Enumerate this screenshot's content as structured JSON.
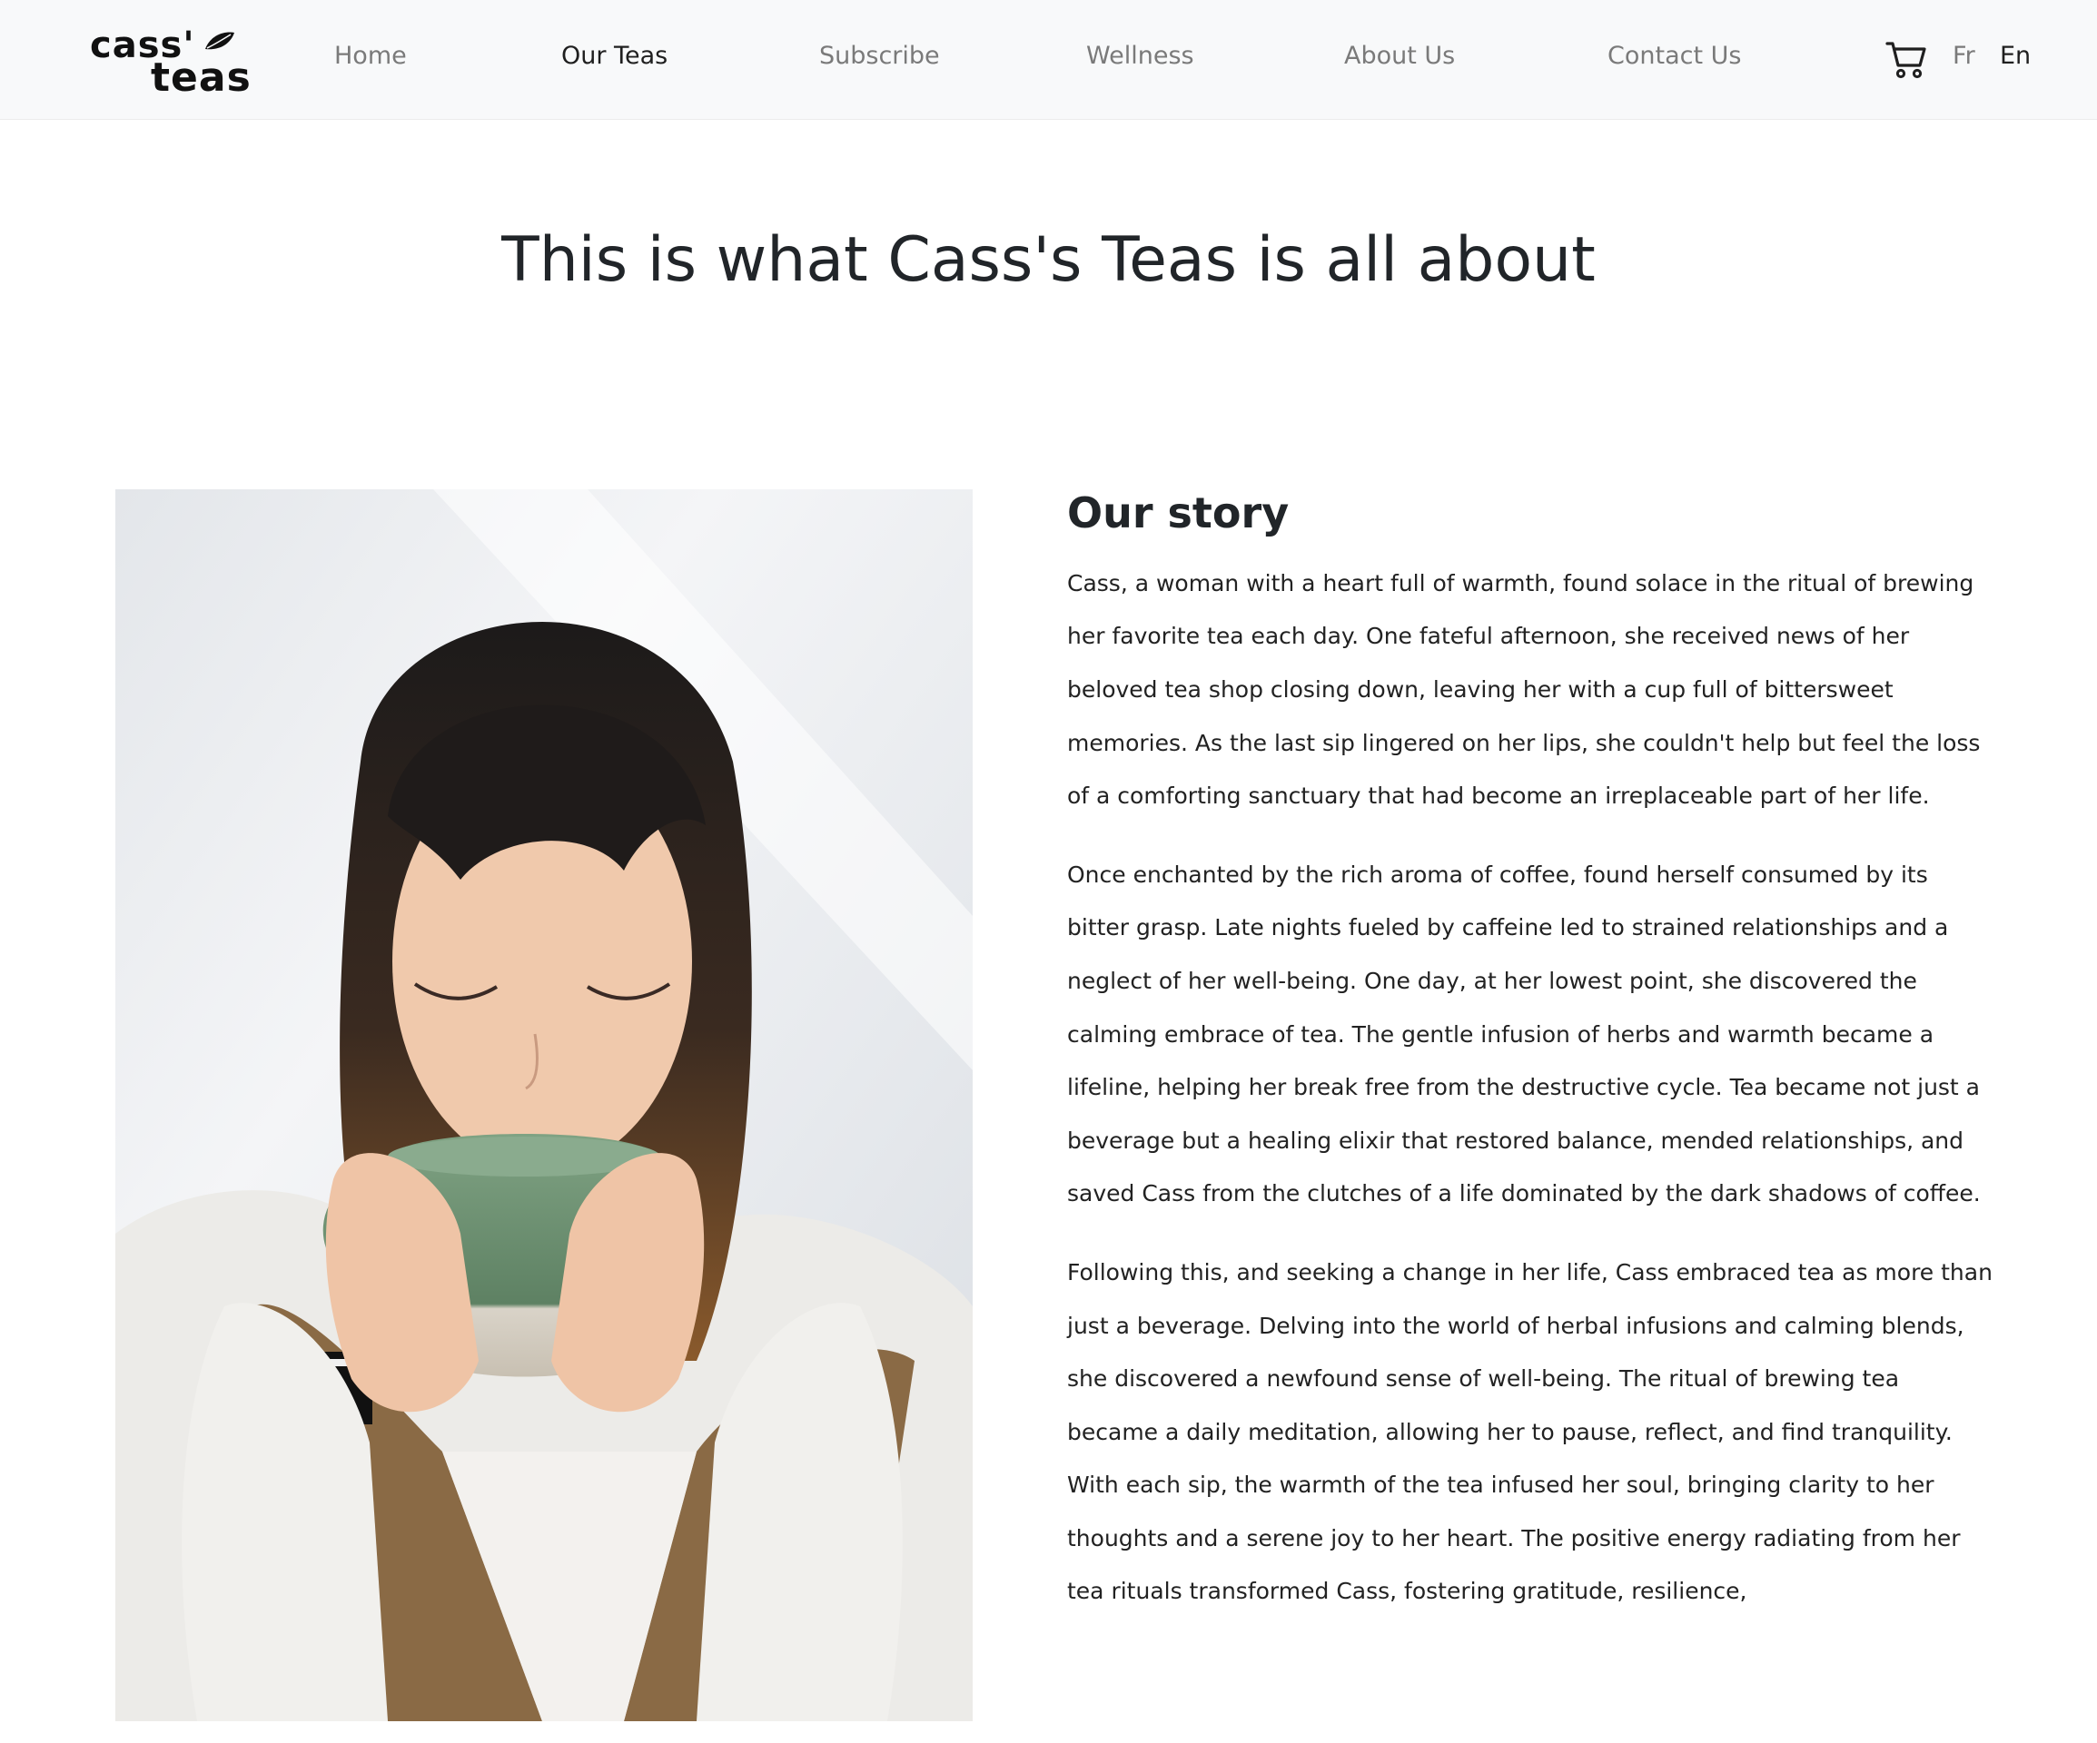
{
  "brand": {
    "line1": "cass'",
    "line2": "teas"
  },
  "nav": {
    "home": "Home",
    "our_teas": "Our Teas",
    "subscribe": "Subscribe",
    "wellness": "Wellness",
    "about": "About Us",
    "contact": "Contact Us"
  },
  "icons": {
    "cart": "cart-icon",
    "logo_leaf": "leaf-icon"
  },
  "lang": {
    "fr": "Fr",
    "en": "En"
  },
  "hero": {
    "title": "This is what Cass's Teas is all about"
  },
  "story": {
    "heading": "Our story",
    "paragraphs": [
      "Cass, a woman with a heart full of warmth, found solace in the ritual of brewing her favorite tea each day. One fateful afternoon, she received news of her beloved tea shop closing down, leaving her with a cup full of bittersweet memories. As the last sip lingered on her lips, she couldn't help but feel the loss of a comforting sanctuary that had become an irreplaceable part of her life.",
      "Once enchanted by the rich aroma of coffee, found herself consumed by its bitter grasp. Late nights fueled by caffeine led to strained relationships and a neglect of her well-being. One day, at her lowest point, she discovered the calming embrace of tea. The gentle infusion of herbs and warmth became a lifeline, helping her break free from the destructive cycle. Tea became not just a beverage but a healing elixir that restored balance, mended relationships, and saved Cass from the clutches of a life dominated by the dark shadows of coffee.",
      "Following this, and seeking a change in her life, Cass embraced tea as more than just a beverage. Delving into the world of herbal infusions and calming blends, she discovered a newfound sense of well-being. The ritual of brewing tea became a daily meditation, allowing her to pause, reflect, and find tranquility. With each sip, the warmth of the tea infused her soul, bringing clarity to her thoughts and a serene joy to her heart. The positive energy radiating from her tea rituals transformed Cass, fostering gratitude, resilience,"
    ]
  },
  "colors": {
    "nav_bg": "#f8f9fa",
    "text_dark": "#212529",
    "nav_muted": "#7a7a7a",
    "mug_green": "#6f9272",
    "vest_brown": "#8a6a45"
  }
}
